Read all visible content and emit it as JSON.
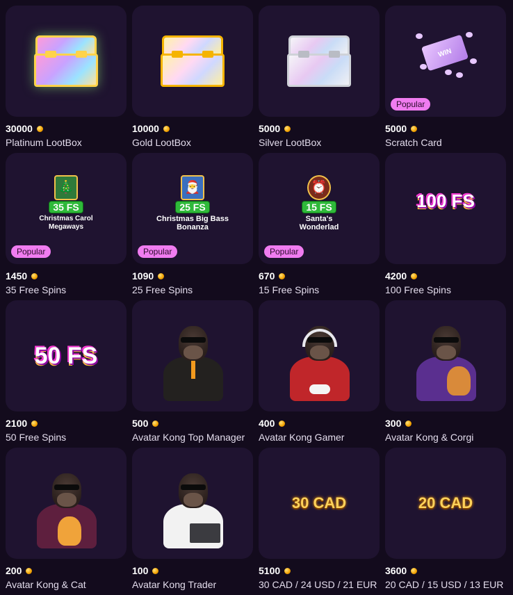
{
  "items": [
    {
      "price": "30000",
      "name": "Platinum LootBox",
      "popular": false,
      "visual": "lootbox-platinum"
    },
    {
      "price": "10000",
      "name": "Gold LootBox",
      "popular": false,
      "visual": "lootbox-gold"
    },
    {
      "price": "5000",
      "name": "Silver LootBox",
      "popular": false,
      "visual": "lootbox-silver"
    },
    {
      "price": "5000",
      "name": "Scratch Card",
      "popular": true,
      "visual": "scratch-card",
      "ticket_text": "WIN"
    },
    {
      "price": "1450",
      "name": "35 Free Spins",
      "popular": true,
      "visual": "promo",
      "fs_label": "35 FS",
      "promo_title": "Christmas Carol Megaways"
    },
    {
      "price": "1090",
      "name": "25 Free Spins",
      "popular": true,
      "visual": "promo",
      "fs_label": "25 FS",
      "promo_title": "Christmas Big Bass Bonanza"
    },
    {
      "price": "670",
      "name": "15 Free Spins",
      "popular": true,
      "visual": "promo",
      "fs_label": "15 FS",
      "promo_title": "Santa's Wonderlad"
    },
    {
      "price": "4200",
      "name": "100 Free Spins",
      "popular": false,
      "visual": "big-fs",
      "big_label": "100 FS"
    },
    {
      "price": "2100",
      "name": "50 Free Spins",
      "popular": false,
      "visual": "big-fs",
      "big_label": "50 FS"
    },
    {
      "price": "500",
      "name": "Avatar Kong Top Manager",
      "popular": false,
      "visual": "avatar-manager"
    },
    {
      "price": "400",
      "name": "Avatar Kong Gamer",
      "popular": false,
      "visual": "avatar-gamer"
    },
    {
      "price": "300",
      "name": "Avatar Kong & Corgi",
      "popular": false,
      "visual": "avatar-corgi"
    },
    {
      "price": "200",
      "name": "Avatar Kong & Cat",
      "popular": false,
      "visual": "avatar-cat"
    },
    {
      "price": "100",
      "name": "Avatar Kong Trader",
      "popular": false,
      "visual": "avatar-trader"
    },
    {
      "price": "5100",
      "name": "30 CAD / 24 USD / 21 EUR",
      "popular": false,
      "visual": "cash",
      "cash_label": "30 CAD"
    },
    {
      "price": "3600",
      "name": "20 CAD / 15 USD / 13 EUR",
      "popular": false,
      "visual": "cash",
      "cash_label": "20 CAD"
    }
  ],
  "badge_label": "Popular",
  "currency_icon": "coin-icon",
  "colors": {
    "background": "#130b1d",
    "card": "#1f1330",
    "badge": "#f07cf0",
    "coin": "#f2a100"
  }
}
